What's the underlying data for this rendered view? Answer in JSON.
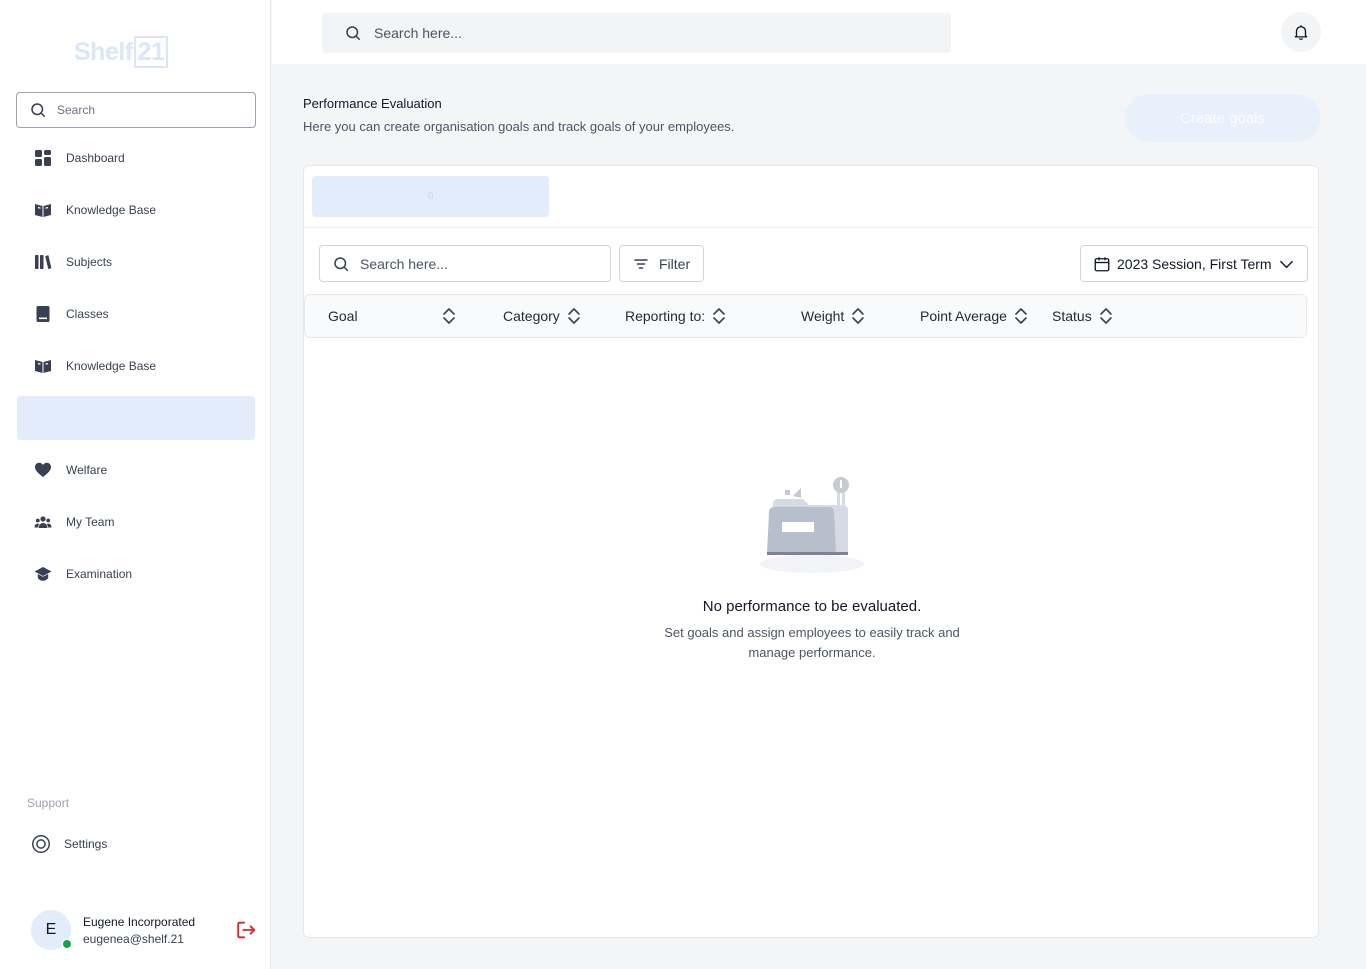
{
  "app": {
    "logo_text": "Shelf",
    "logo_number": "21"
  },
  "sidebar": {
    "search_placeholder": "Search",
    "items": [
      {
        "label": "Dashboard",
        "icon": "dashboard-grid-icon"
      },
      {
        "label": "Knowledge Base",
        "icon": "open-book-icon"
      },
      {
        "label": "Subjects",
        "icon": "books-icon"
      },
      {
        "label": "Classes",
        "icon": "notebook-icon"
      },
      {
        "label": "Knowledge Base",
        "icon": "open-book-icon"
      },
      {
        "label": "",
        "icon": "",
        "active": true
      },
      {
        "label": "Welfare",
        "icon": "heart-icon"
      },
      {
        "label": "My Team",
        "icon": "team-icon"
      },
      {
        "label": "Examination",
        "icon": "graduation-cap-icon"
      }
    ],
    "support_label": "Support",
    "settings_label": "Settings",
    "user": {
      "initial": "E",
      "name": "Eugene Incorporated",
      "email": "eugenea@shelf.21",
      "status_color": "#16a34a"
    }
  },
  "topbar": {
    "search_placeholder": "Search here..."
  },
  "page": {
    "title": "Performance Evaluation",
    "subtitle": "Here you can create organisation goals and track goals of your employees.",
    "create_button": "Create goals",
    "tab_label": "0"
  },
  "table": {
    "search_placeholder": "Search here...",
    "filter_label": "Filter",
    "session_label": "2023 Session, First Term",
    "columns": [
      "Goal",
      "Category",
      "Reporting to:",
      "Weight",
      "Point Average",
      "Status"
    ]
  },
  "empty_state": {
    "title": "No performance to be evaluated.",
    "description": "Set goals and assign employees  to easily track and manage performance."
  },
  "colors": {
    "accent_light": "#e3ecfa",
    "logout": "#dc2626"
  }
}
